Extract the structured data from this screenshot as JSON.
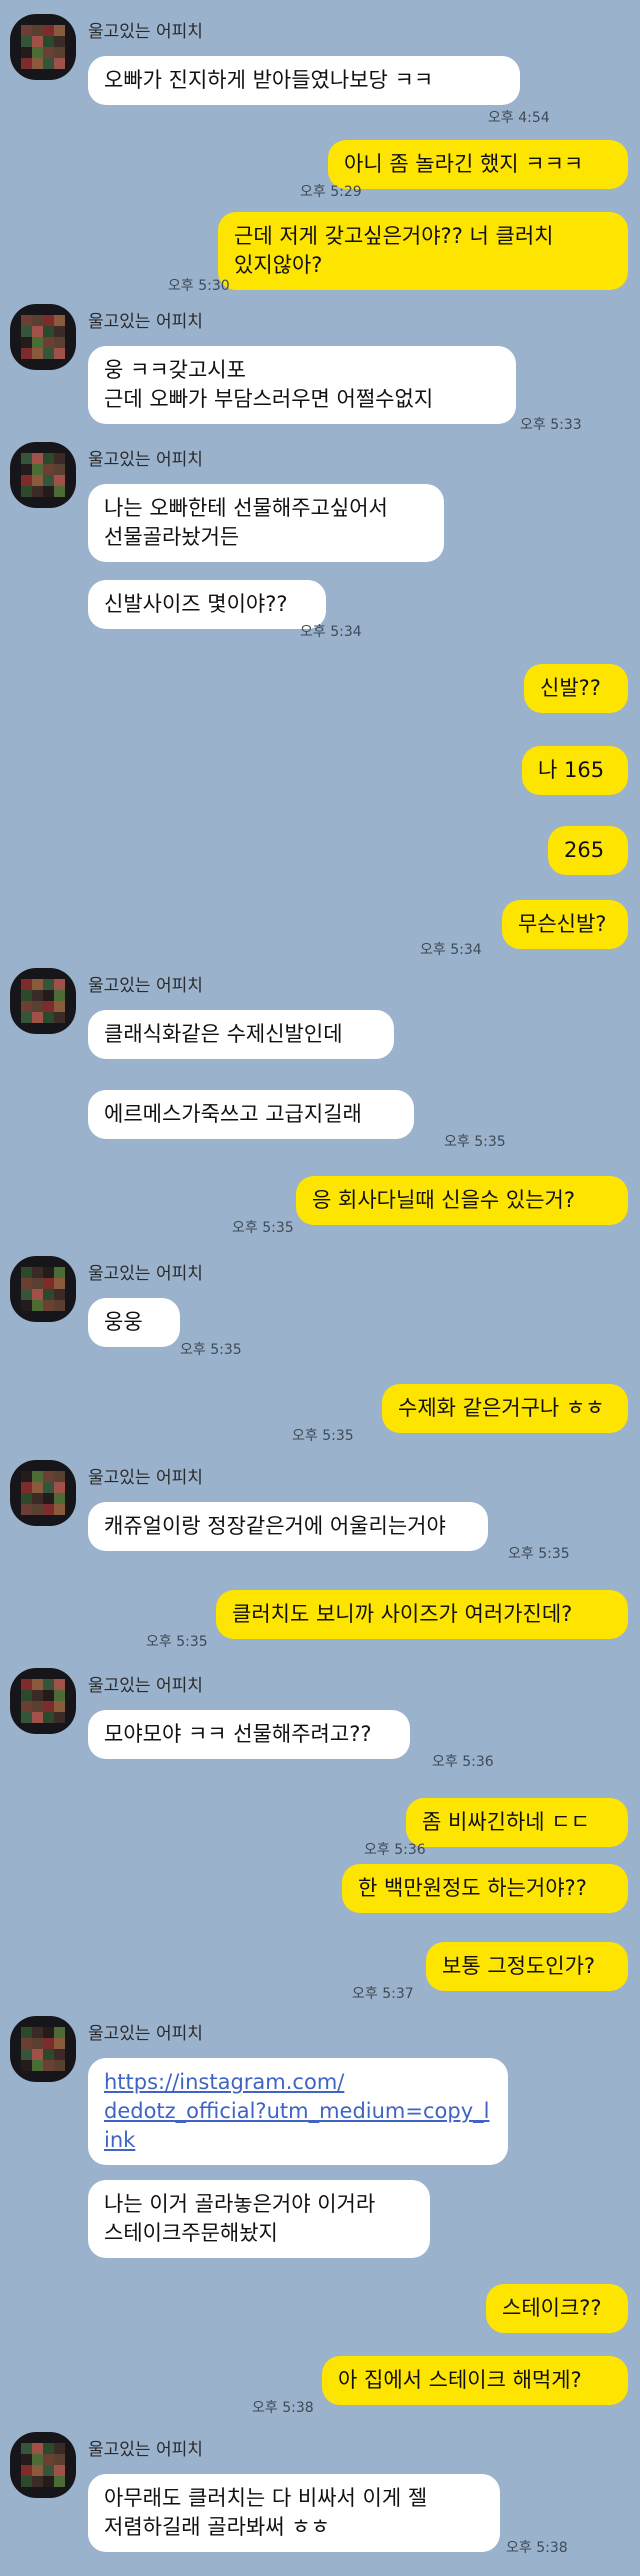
{
  "chat": {
    "sender_name": "울고있는 어피치",
    "messages": [
      {
        "dir": "in",
        "lines": [
          "오빠가 진지하게 받아들였나보당 ㅋㅋ"
        ],
        "time": "오후 4:54",
        "avatar": true
      },
      {
        "dir": "out",
        "lines": [
          "아니 좀 놀라긴 했지 ㅋㅋㅋ"
        ],
        "time": "오후 5:29"
      },
      {
        "dir": "out",
        "lines": [
          "근데 저게 갖고싶은거야?? 너 클러치",
          "있지않아?"
        ],
        "time": "오후 5:30"
      },
      {
        "dir": "in",
        "lines": [
          "웅 ㅋㅋ갖고시포",
          "근데 오빠가 부담스러우면 어쩔수없지"
        ],
        "time": "오후 5:33",
        "avatar": true
      },
      {
        "dir": "in",
        "lines": [
          "나는 오빠한테 선물해주고싶어서",
          "선물골라놨거든"
        ],
        "time": "",
        "avatar": true
      },
      {
        "dir": "in",
        "lines": [
          "신발사이즈 몇이야??"
        ],
        "time": "오후 5:34"
      },
      {
        "dir": "out",
        "lines": [
          "신발??"
        ],
        "time": ""
      },
      {
        "dir": "out",
        "lines": [
          "나 165"
        ],
        "time": ""
      },
      {
        "dir": "out",
        "lines": [
          "265"
        ],
        "time": ""
      },
      {
        "dir": "out",
        "lines": [
          "무슨신발?"
        ],
        "time": "오후 5:34"
      },
      {
        "dir": "in",
        "lines": [
          "클래식화같은 수제신발인데"
        ],
        "time": "",
        "avatar": true
      },
      {
        "dir": "in",
        "lines": [
          "에르메스가죽쓰고 고급지길래"
        ],
        "time": "오후 5:35"
      },
      {
        "dir": "out",
        "lines": [
          "응 회사다닐때 신을수 있는거?"
        ],
        "time": "오후 5:35"
      },
      {
        "dir": "in",
        "lines": [
          "웅웅"
        ],
        "time": "오후 5:35",
        "avatar": true
      },
      {
        "dir": "out",
        "lines": [
          "수제화 같은거구나 ㅎㅎ"
        ],
        "time": "오후 5:35"
      },
      {
        "dir": "in",
        "lines": [
          "캐쥬얼이랑 정장같은거에 어울리는거야"
        ],
        "time": "오후 5:35",
        "avatar": true
      },
      {
        "dir": "out",
        "lines": [
          "클러치도 보니까 사이즈가 여러가진데?"
        ],
        "time": "오후 5:35"
      },
      {
        "dir": "in",
        "lines": [
          "모야모야 ㅋㅋ 선물해주려고??"
        ],
        "time": "오후 5:36",
        "avatar": true
      },
      {
        "dir": "out",
        "lines": [
          "좀 비싸긴하네 ㄷㄷ"
        ],
        "time": "오후 5:36"
      },
      {
        "dir": "out",
        "lines": [
          "한 백만원정도 하는거야??"
        ],
        "time": ""
      },
      {
        "dir": "out",
        "lines": [
          "보통 그정도인가?"
        ],
        "time": "오후 5:37"
      },
      {
        "dir": "in",
        "lines": [
          "https://instagram.com/",
          "dedotz_official?utm_medium=copy_l",
          "ink"
        ],
        "time": "",
        "avatar": true,
        "link": true
      },
      {
        "dir": "in",
        "lines": [
          "나는 이거 골라놓은거야 이거라",
          "스테이크주문해놨지"
        ],
        "time": ""
      },
      {
        "dir": "out",
        "lines": [
          "스테이크??"
        ],
        "time": ""
      },
      {
        "dir": "out",
        "lines": [
          "아 집에서 스테이크 해먹게?"
        ],
        "time": "오후 5:38"
      },
      {
        "dir": "in",
        "lines": [
          "아무래도 클러치는 다 비싸서 이게 젤",
          "저렴하길래 골라봐써 ㅎㅎ"
        ],
        "time": "오후 5:38",
        "avatar": true
      }
    ]
  },
  "colors": {
    "background": "#9bb2cc",
    "incoming_bubble": "#ffffff",
    "outgoing_bubble": "#fee500",
    "link": "#3f64c6"
  }
}
